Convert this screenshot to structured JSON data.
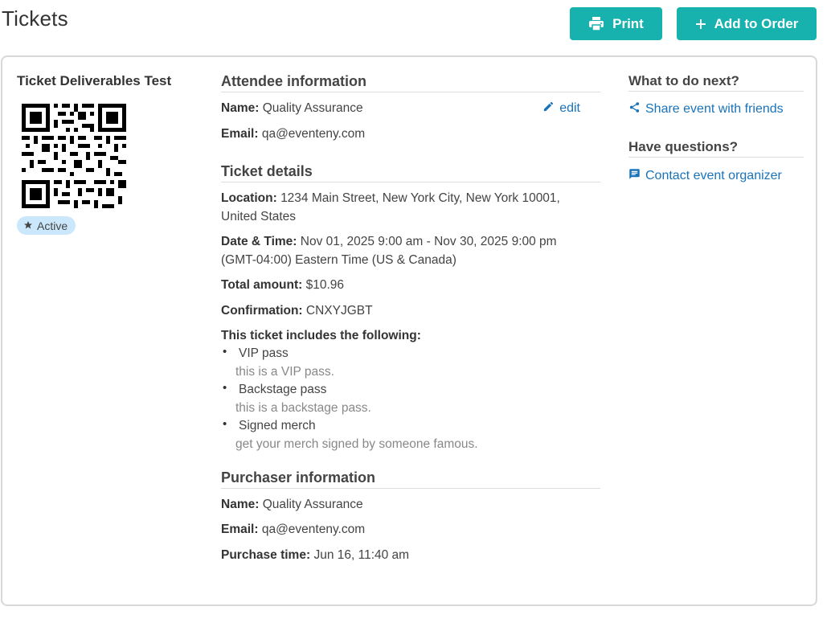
{
  "header": {
    "title": "Tickets",
    "print_label": "Print",
    "add_label": "Add to Order"
  },
  "ticket": {
    "event_name": "Ticket Deliverables Test",
    "status": "Active"
  },
  "attendee": {
    "heading": "Attendee information",
    "name_label": "Name:",
    "name_value": "Quality Assurance",
    "email_label": "Email:",
    "email_value": "qa@eventeny.com",
    "edit_label": "edit"
  },
  "details": {
    "heading": "Ticket details",
    "location_label": "Location:",
    "location_line1": "1234 Main Street, New York City, New York 10001,",
    "location_line2": "United States",
    "datetime_label": "Date & Time:",
    "datetime_line1": "Nov 01, 2025 9:00 am - Nov 30, 2025 9:00 pm",
    "datetime_line2": "(GMT-04:00) Eastern Time (US & Canada)",
    "total_label": "Total amount:",
    "total_value": "$10.96",
    "confirmation_label": "Confirmation:",
    "confirmation_value": "CNXYJGBT",
    "includes_label": "This ticket includes the following:",
    "includes": [
      {
        "name": "VIP pass",
        "desc": "this is a VIP pass."
      },
      {
        "name": "Backstage pass",
        "desc": "this is a backstage pass."
      },
      {
        "name": "Signed merch",
        "desc": "get your merch signed by someone famous."
      }
    ]
  },
  "purchaser": {
    "heading": "Purchaser information",
    "name_label": "Name:",
    "name_value": "Quality Assurance",
    "email_label": "Email:",
    "email_value": "qa@eventeny.com",
    "time_label": "Purchase time:",
    "time_value": "Jun 16, 11:40 am"
  },
  "sidebar": {
    "next_heading": "What to do next?",
    "share_label": "Share event with friends",
    "questions_heading": "Have questions?",
    "contact_label": "Contact event organizer"
  },
  "icons": {
    "print": "printer-icon",
    "add": "plus-icon",
    "star": "star-icon",
    "edit": "pencil-icon",
    "share": "share-icon",
    "contact": "chat-icon",
    "qr": "qr-code"
  },
  "colors": {
    "accent": "#17b2ae",
    "link": "#1a73b9",
    "badge_bg": "#cbe7fb"
  }
}
